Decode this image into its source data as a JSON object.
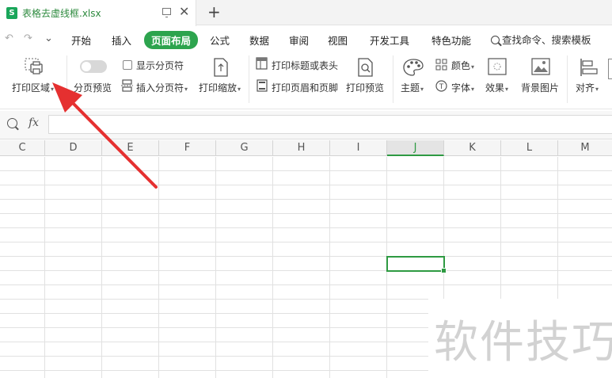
{
  "window": {
    "doc_tab_title": "表格去虚线框.xlsx",
    "logo_letter": "S",
    "new_tab_symbol": "+"
  },
  "menu": {
    "undo": "↶",
    "redo": "↷",
    "more": "⌄",
    "items": [
      "开始",
      "插入",
      "页面布局",
      "公式",
      "数据",
      "审阅",
      "视图",
      "开发工具",
      "特色功能"
    ],
    "active_item": "页面布局",
    "search_text": "查找命令、搜索模板"
  },
  "ribbon": {
    "print_area": "打印区域",
    "page_break_preview": "分页预览",
    "show_page_breaks": "显示分页符",
    "insert_page_break": "插入分页符",
    "print_scale": "打印缩放",
    "print_titles": "打印标题或表头",
    "print_header_footer": "打印页眉和页脚",
    "print_preview": "打印预览",
    "theme": "主题",
    "colors": "颜色",
    "fonts": "字体",
    "effects": "效果",
    "background_image": "背景图片",
    "align": "对齐",
    "show_page_breaks_checked": false,
    "page_break_toggle_on": false
  },
  "formula_bar": {
    "fx_label": "fx",
    "value": ""
  },
  "sheet": {
    "columns": [
      "C",
      "D",
      "E",
      "F",
      "G",
      "H",
      "I",
      "J",
      "K",
      "L",
      "M"
    ],
    "selected_column": "J"
  },
  "watermark": "软件技巧",
  "colors": {
    "accent_green": "#2da44e",
    "arrow_red": "#e53030"
  }
}
